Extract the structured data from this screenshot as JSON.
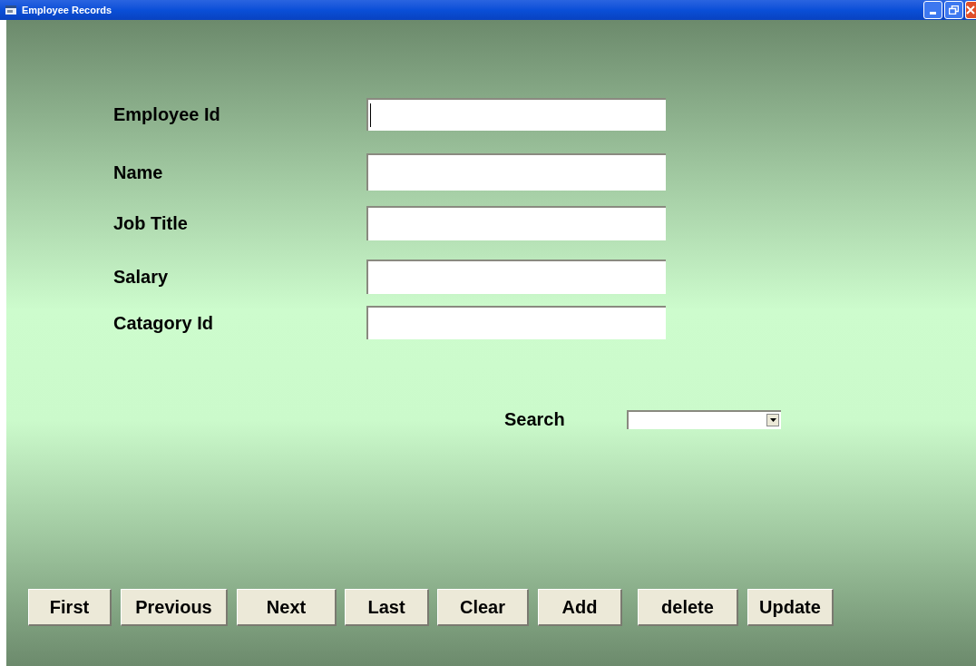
{
  "window": {
    "title": "Employee Records"
  },
  "fields": [
    {
      "label": "Employee Id",
      "focused": true
    },
    {
      "label": "Name",
      "focused": false
    },
    {
      "label": "Job Title",
      "focused": false
    },
    {
      "label": "Salary",
      "focused": false
    },
    {
      "label": "Catagory Id",
      "focused": false
    }
  ],
  "search": {
    "label": "Search"
  },
  "buttons": [
    "First",
    "Previous",
    "Next",
    "Last",
    "Clear",
    "Add",
    "delete",
    "Update"
  ]
}
